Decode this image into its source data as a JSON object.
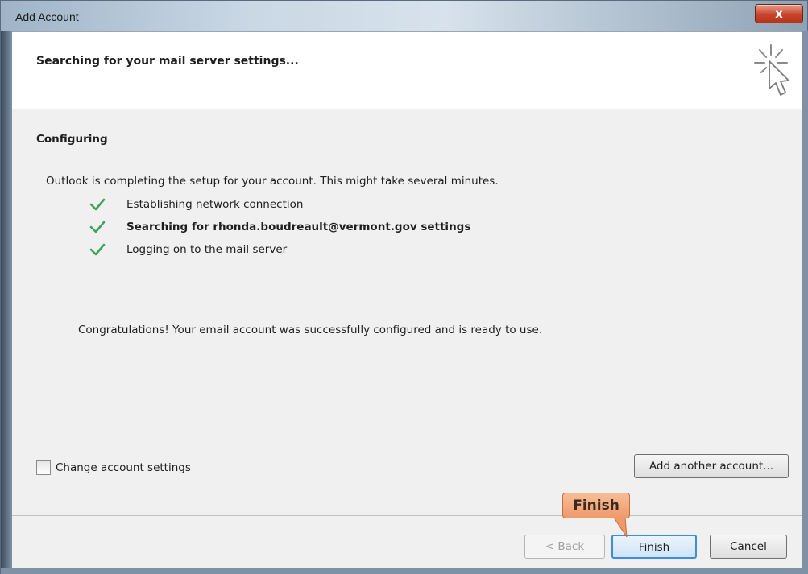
{
  "window": {
    "title": "Add Account",
    "close_label": "x"
  },
  "header": {
    "title": "Searching for your mail server settings...",
    "icon": "cursor-click-icon"
  },
  "section": {
    "title": "Configuring",
    "intro": "Outlook is completing the setup for your account. This might take several minutes."
  },
  "steps": [
    {
      "label": "Establishing network connection",
      "status": "done"
    },
    {
      "label": "Searching for rhonda.boudreault@vermont.gov settings",
      "status": "done"
    },
    {
      "label": "Logging on to the mail server",
      "status": "done"
    }
  ],
  "message": "Congratulations! Your email account was successfully configured and is ready to use.",
  "options": {
    "change_settings_label": "Change account settings",
    "change_settings_checked": false
  },
  "buttons": {
    "add_another": "Add another account...",
    "back": "< Back",
    "finish": "Finish",
    "cancel": "Cancel"
  },
  "callout": {
    "label": "Finish"
  },
  "colors": {
    "check": "#3fa35c",
    "callout": "#f0a174",
    "finish_border": "#3c8fd6"
  }
}
